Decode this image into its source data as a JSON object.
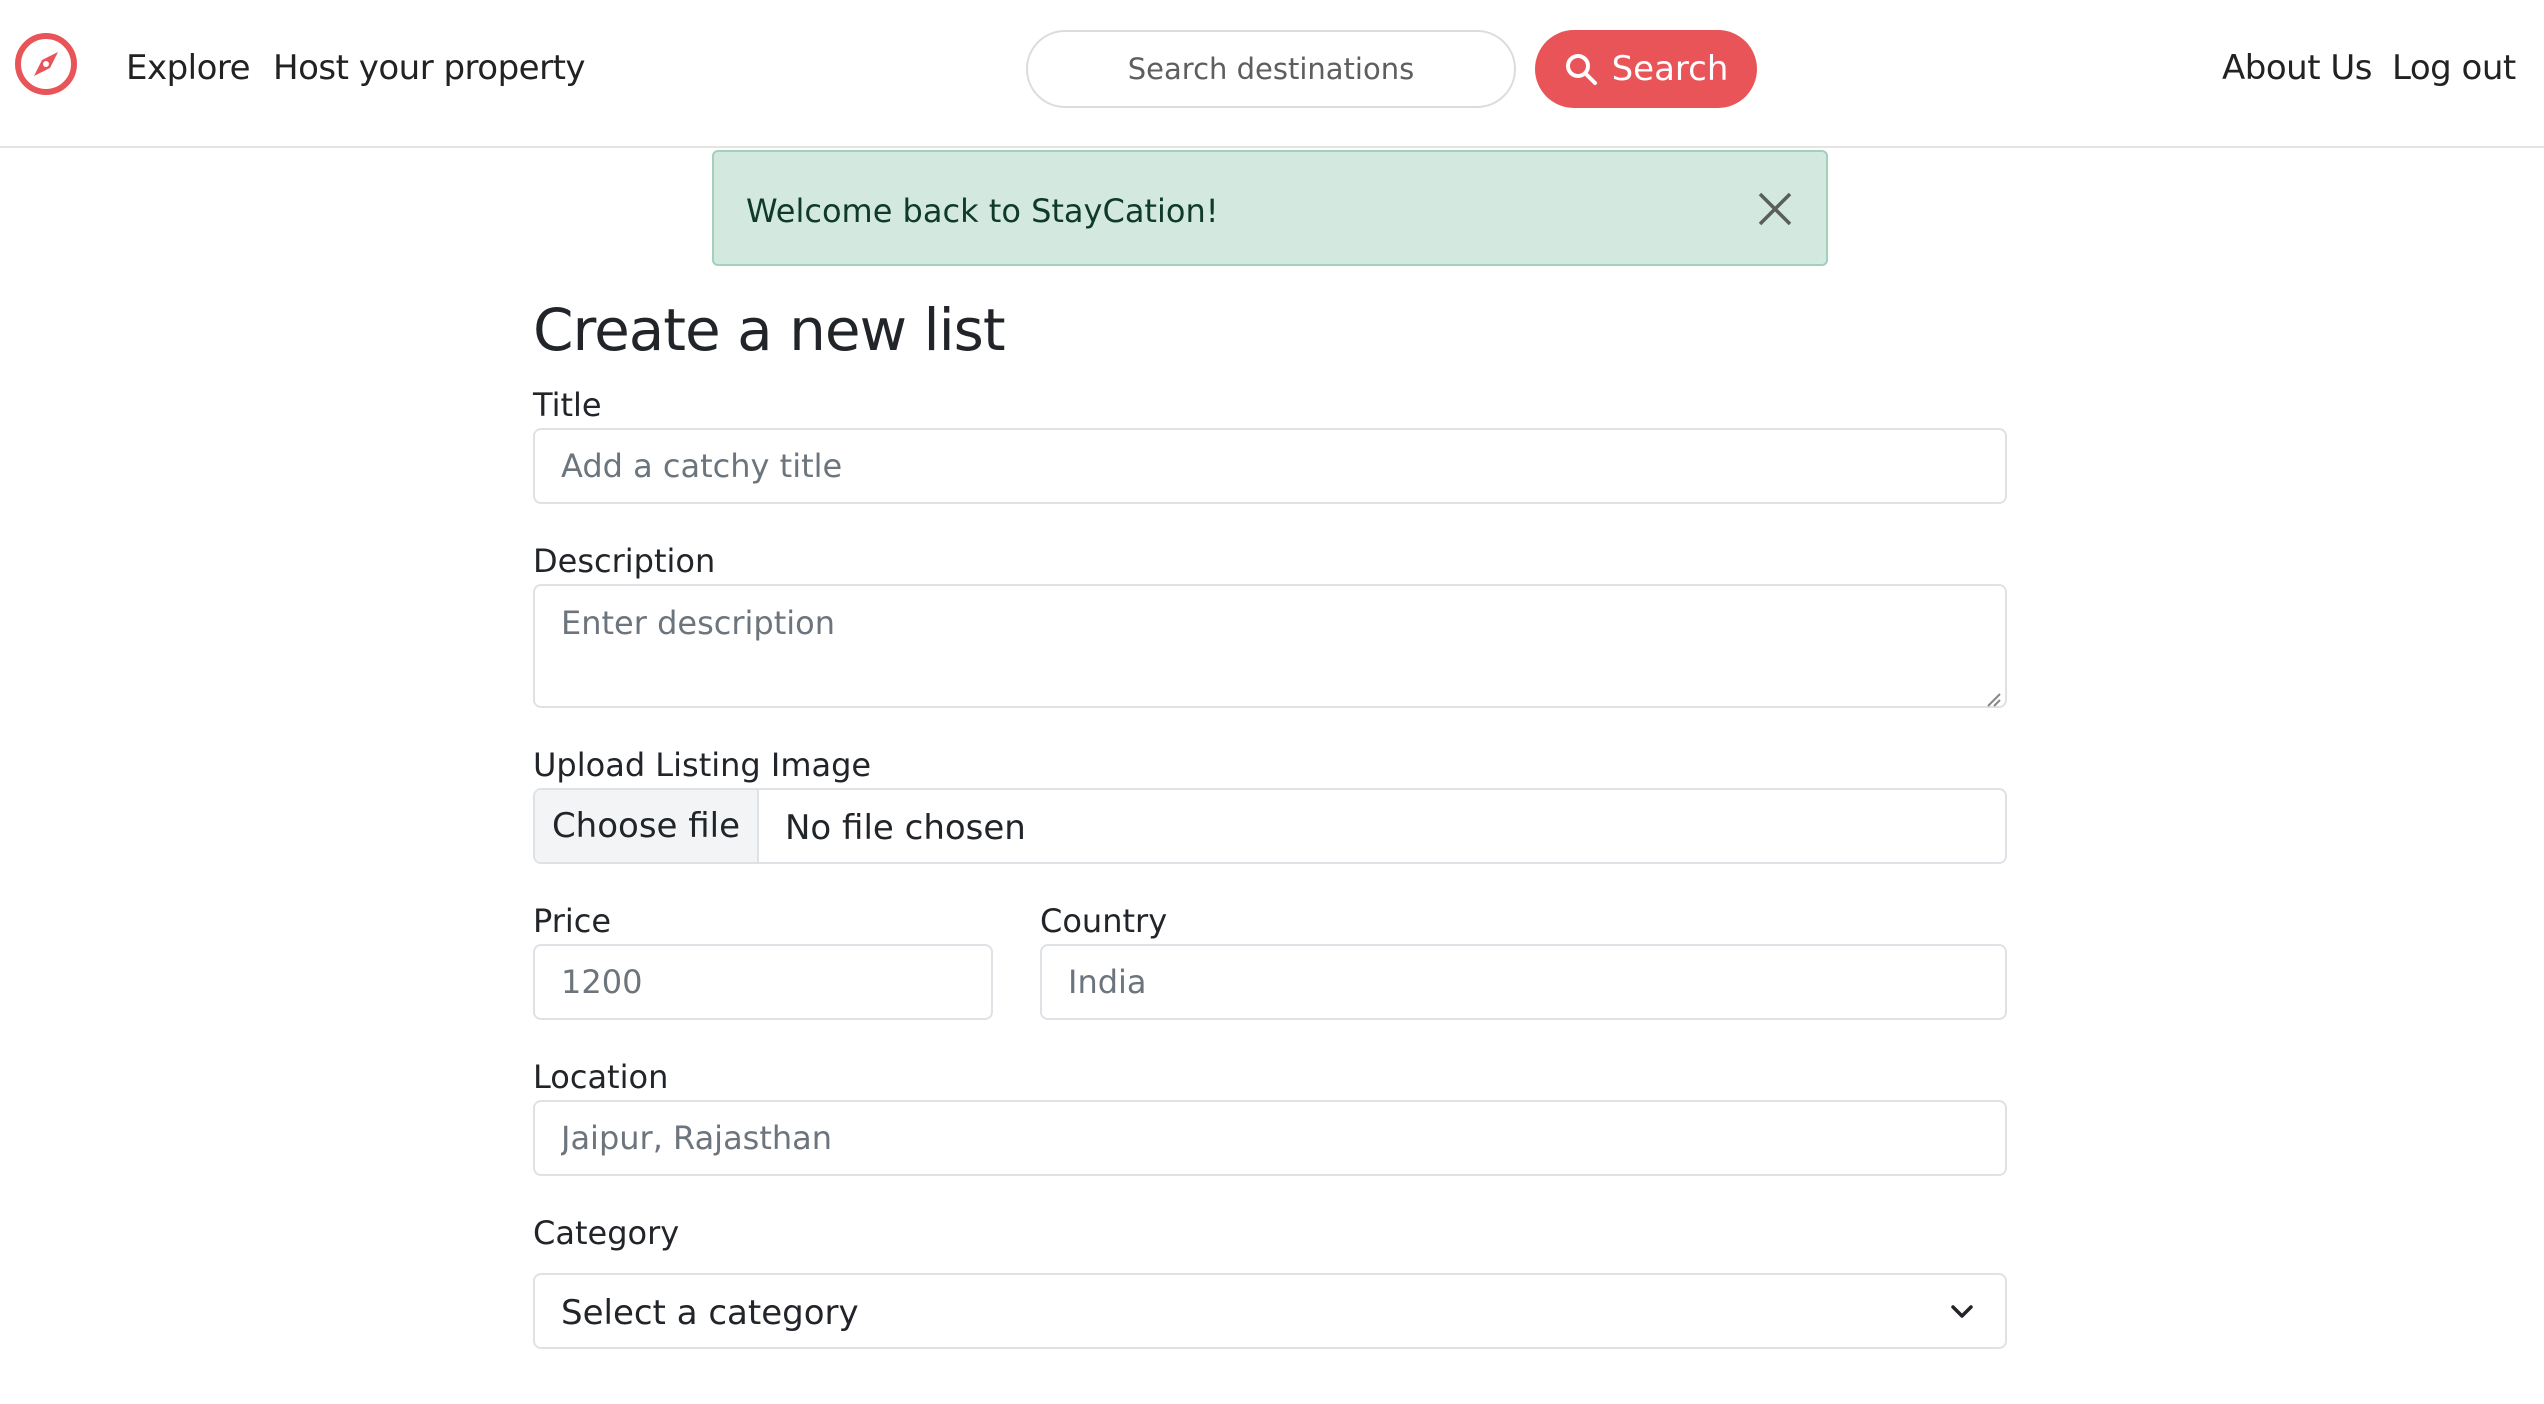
{
  "nav": {
    "explore": "Explore",
    "host": "Host your property",
    "about": "About Us",
    "logout": "Log out"
  },
  "search": {
    "placeholder": "Search destinations",
    "button_label": "Search"
  },
  "alert": {
    "message": "Welcome back to StayCation!"
  },
  "form": {
    "heading": "Create a new list",
    "title_label": "Title",
    "title_placeholder": "Add a catchy title",
    "description_label": "Description",
    "description_placeholder": "Enter description",
    "image_label": "Upload Listing Image",
    "file_button": "Choose file",
    "file_status": "No file chosen",
    "price_label": "Price",
    "price_placeholder": "1200",
    "country_label": "Country",
    "country_placeholder": "India",
    "location_label": "Location",
    "location_placeholder": "Jaipur, Rajasthan",
    "category_label": "Category",
    "category_selected": "Select a category"
  },
  "colors": {
    "brand": "#e85458",
    "alert_bg": "#d3e8df",
    "alert_border": "#a3cfbb",
    "input_border": "#dee2e6"
  },
  "icons": {
    "logo": "compass-icon",
    "search": "search-icon",
    "close": "close-icon",
    "chevron": "chevron-down-icon"
  }
}
